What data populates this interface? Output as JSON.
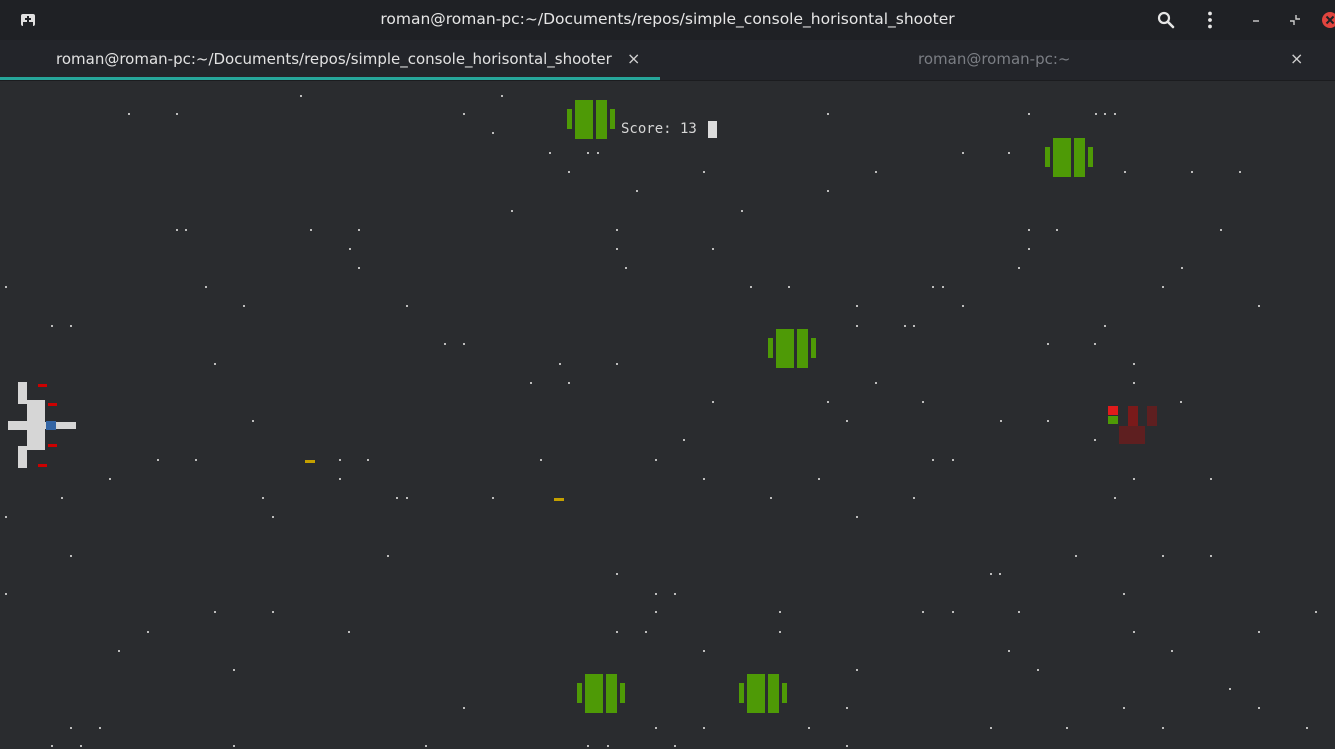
{
  "window": {
    "title": "roman@roman-pc:~/Documents/repos/simple_console_horisontal_shooter",
    "icons": [
      "new-tab-icon",
      "search-icon",
      "menu-icon",
      "minimize-icon",
      "restore-icon",
      "close-icon"
    ]
  },
  "tabs": [
    {
      "label": "roman@roman-pc:~/Documents/repos/simple_console_horisontal_shooter",
      "active": true,
      "close": "×"
    },
    {
      "label": "roman@roman-pc:~",
      "active": false,
      "close": "×"
    }
  ],
  "game": {
    "score_label": "Score: 13",
    "enemy_count": 6,
    "bullet_count": 2,
    "colors": {
      "background": "#2a2c2f",
      "enemy": "#4e9a06",
      "ship": "#d6d6d6",
      "engine": "#3465a4",
      "laser": "#c4a000",
      "explosion": "#7a1a1a",
      "accent": "#26a69a",
      "close_red": "#e0443e"
    }
  }
}
